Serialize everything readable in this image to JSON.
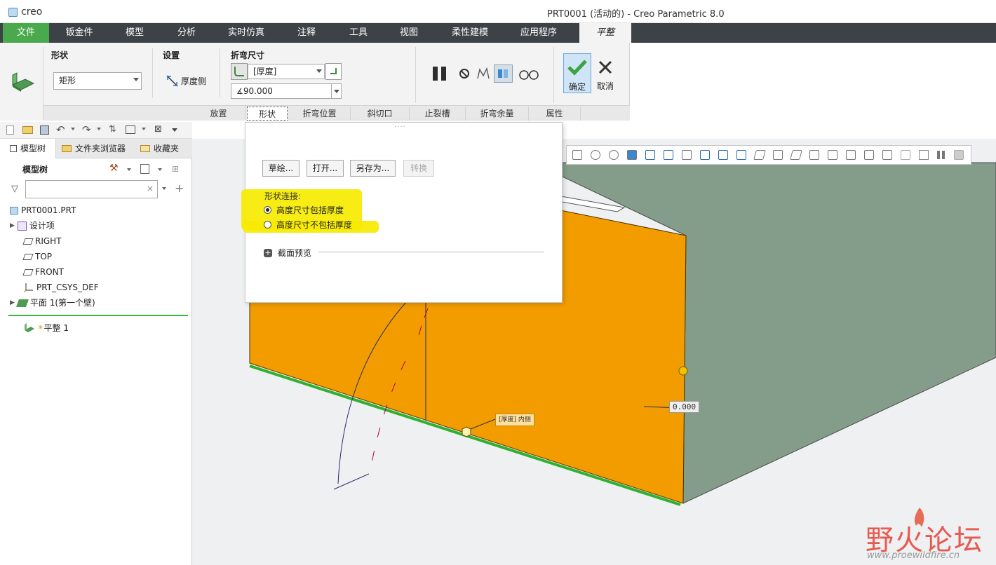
{
  "window": {
    "app_name": "creo",
    "title": "PRT0001 (活动的) - Creo Parametric 8.0"
  },
  "menubar": {
    "items": [
      "文件",
      "钣金件",
      "模型",
      "分析",
      "实时仿真",
      "注释",
      "工具",
      "视图",
      "柔性建模",
      "应用程序",
      "平整"
    ],
    "active": "平整"
  },
  "ribbon": {
    "shape_group": {
      "title": "形状",
      "value": "矩形"
    },
    "settings_group": {
      "title": "设置",
      "thickness_side": "厚度侧"
    },
    "bend_group": {
      "title": "折弯尺寸",
      "radius_value": "[厚度]",
      "angle_value": "90.000"
    },
    "ok_label": "确定",
    "cancel_label": "取消",
    "tabs": [
      "放置",
      "形状",
      "折弯位置",
      "斜切口",
      "止裂槽",
      "折弯余量",
      "属性"
    ],
    "active_tab": "形状"
  },
  "left_panel": {
    "tabs": [
      "模型树",
      "文件夹浏览器",
      "收藏夹"
    ],
    "tree_title": "模型树",
    "search_placeholder": "",
    "tree_items": [
      {
        "label": "PRT0001.PRT",
        "icon": "part-icon"
      },
      {
        "label": "设计项",
        "icon": "design-items-icon"
      },
      {
        "label": "RIGHT",
        "icon": "datum-plane-icon"
      },
      {
        "label": "TOP",
        "icon": "datum-plane-icon"
      },
      {
        "label": "FRONT",
        "icon": "datum-plane-icon"
      },
      {
        "label": "PRT_CSYS_DEF",
        "icon": "coordinate-system-icon"
      },
      {
        "label": "平面 1(第一个壁)",
        "icon": "planar-wall-icon"
      }
    ],
    "insert_item": {
      "label": "平整 1",
      "icon": "flat-wall-icon"
    }
  },
  "shape_panel": {
    "buttons": [
      "草绘...",
      "打开...",
      "另存为...",
      "转换"
    ],
    "connection_label": "形状连接:",
    "options": [
      {
        "label": "高度尺寸包括厚度",
        "selected": true
      },
      {
        "label": "高度尺寸不包括厚度",
        "selected": false
      }
    ],
    "section_preview": "截面预览"
  },
  "viewport": {
    "dimension_value": "0.000",
    "callout_label": "[厚度] 内侧",
    "colors": {
      "wall": "#f29c00",
      "side": "#849d8a",
      "background": "#eef0f2",
      "edge": "#2fb12f"
    }
  },
  "watermark": {
    "title": "野火论坛",
    "url": "www.proewildfire.cn"
  }
}
